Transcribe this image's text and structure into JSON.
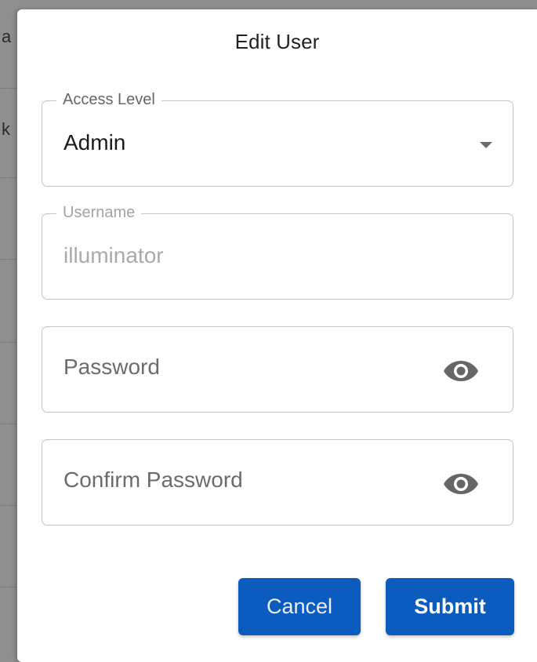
{
  "background": {
    "peek_chars": [
      "a",
      "k"
    ]
  },
  "dialog": {
    "title": "Edit User",
    "access_level": {
      "label": "Access Level",
      "value": "Admin",
      "icon": "arrow-drop-down-icon"
    },
    "username": {
      "label": "Username",
      "value": "illuminator"
    },
    "password": {
      "placeholder": "Password",
      "icon": "eye-icon"
    },
    "confirm_password": {
      "placeholder": "Confirm Password",
      "icon": "eye-icon"
    },
    "buttons": {
      "cancel_label": "Cancel",
      "submit_label": "Submit"
    }
  },
  "colors": {
    "primary": "#0c5bbf",
    "backdrop": "#8f8f8f",
    "border": "#c4c4c4",
    "icon": "#666666"
  }
}
